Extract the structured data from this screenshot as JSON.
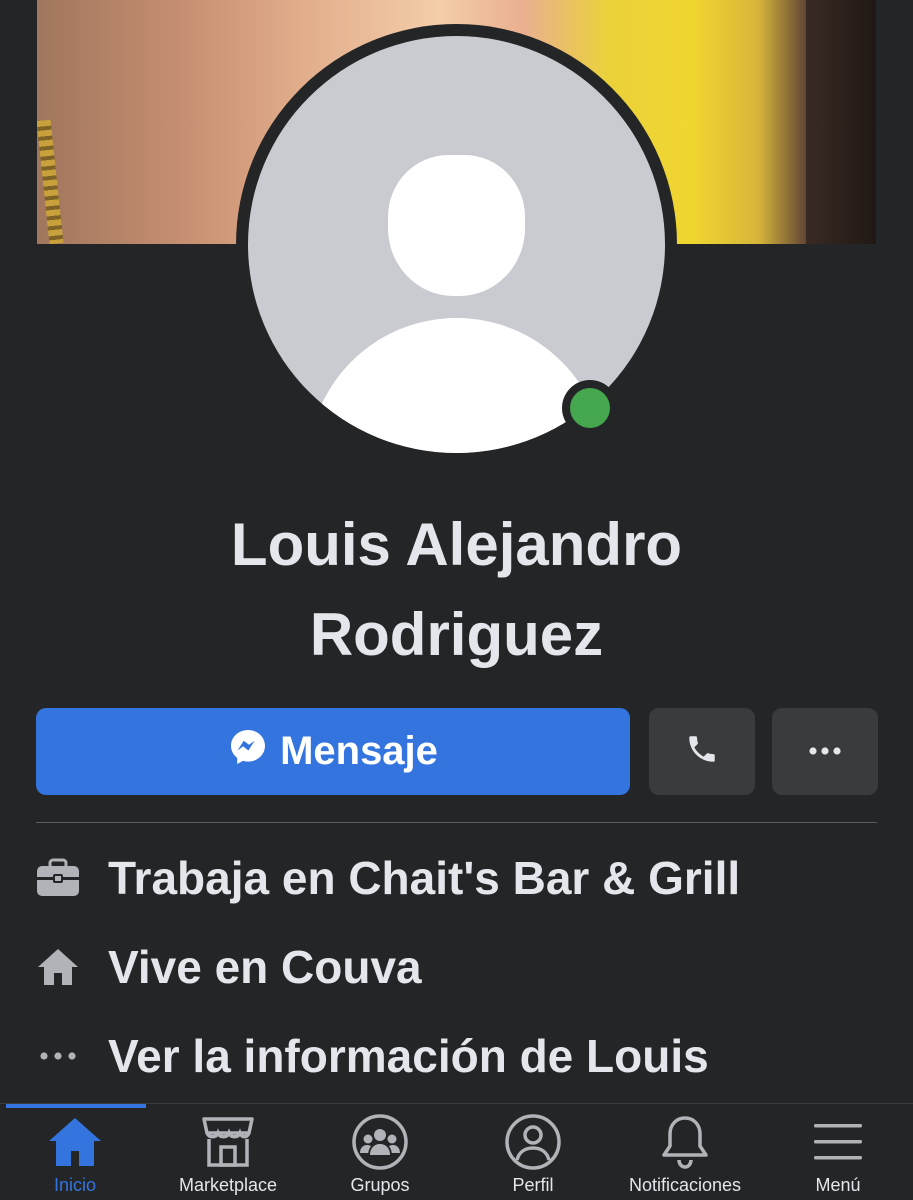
{
  "profile": {
    "name_line1": "Louis Alejandro",
    "name_line2": "Rodriguez",
    "online": true
  },
  "actions": {
    "message_label": "Mensaje",
    "call_icon": "phone-icon",
    "more_icon": "more-icon"
  },
  "info": [
    {
      "icon": "briefcase-icon",
      "text": "Trabaja en Chait's Bar & Grill"
    },
    {
      "icon": "home-icon",
      "text": "Vive en Couva"
    },
    {
      "icon": "more-icon",
      "text": "Ver la información de Louis"
    }
  ],
  "nav": {
    "items": [
      {
        "icon": "home-icon",
        "label": "Inicio",
        "active": true
      },
      {
        "icon": "marketplace-icon",
        "label": "Marketplace"
      },
      {
        "icon": "groups-icon",
        "label": "Grupos"
      },
      {
        "icon": "profile-icon",
        "label": "Perfil"
      },
      {
        "icon": "bell-icon",
        "label": "Notificaciones"
      },
      {
        "icon": "menu-icon",
        "label": "Menú"
      }
    ]
  },
  "colors": {
    "background": "#242526",
    "accent": "#3374df",
    "online": "#45a84f",
    "button_secondary": "#3a3b3c",
    "text": "#e4e6eb"
  }
}
